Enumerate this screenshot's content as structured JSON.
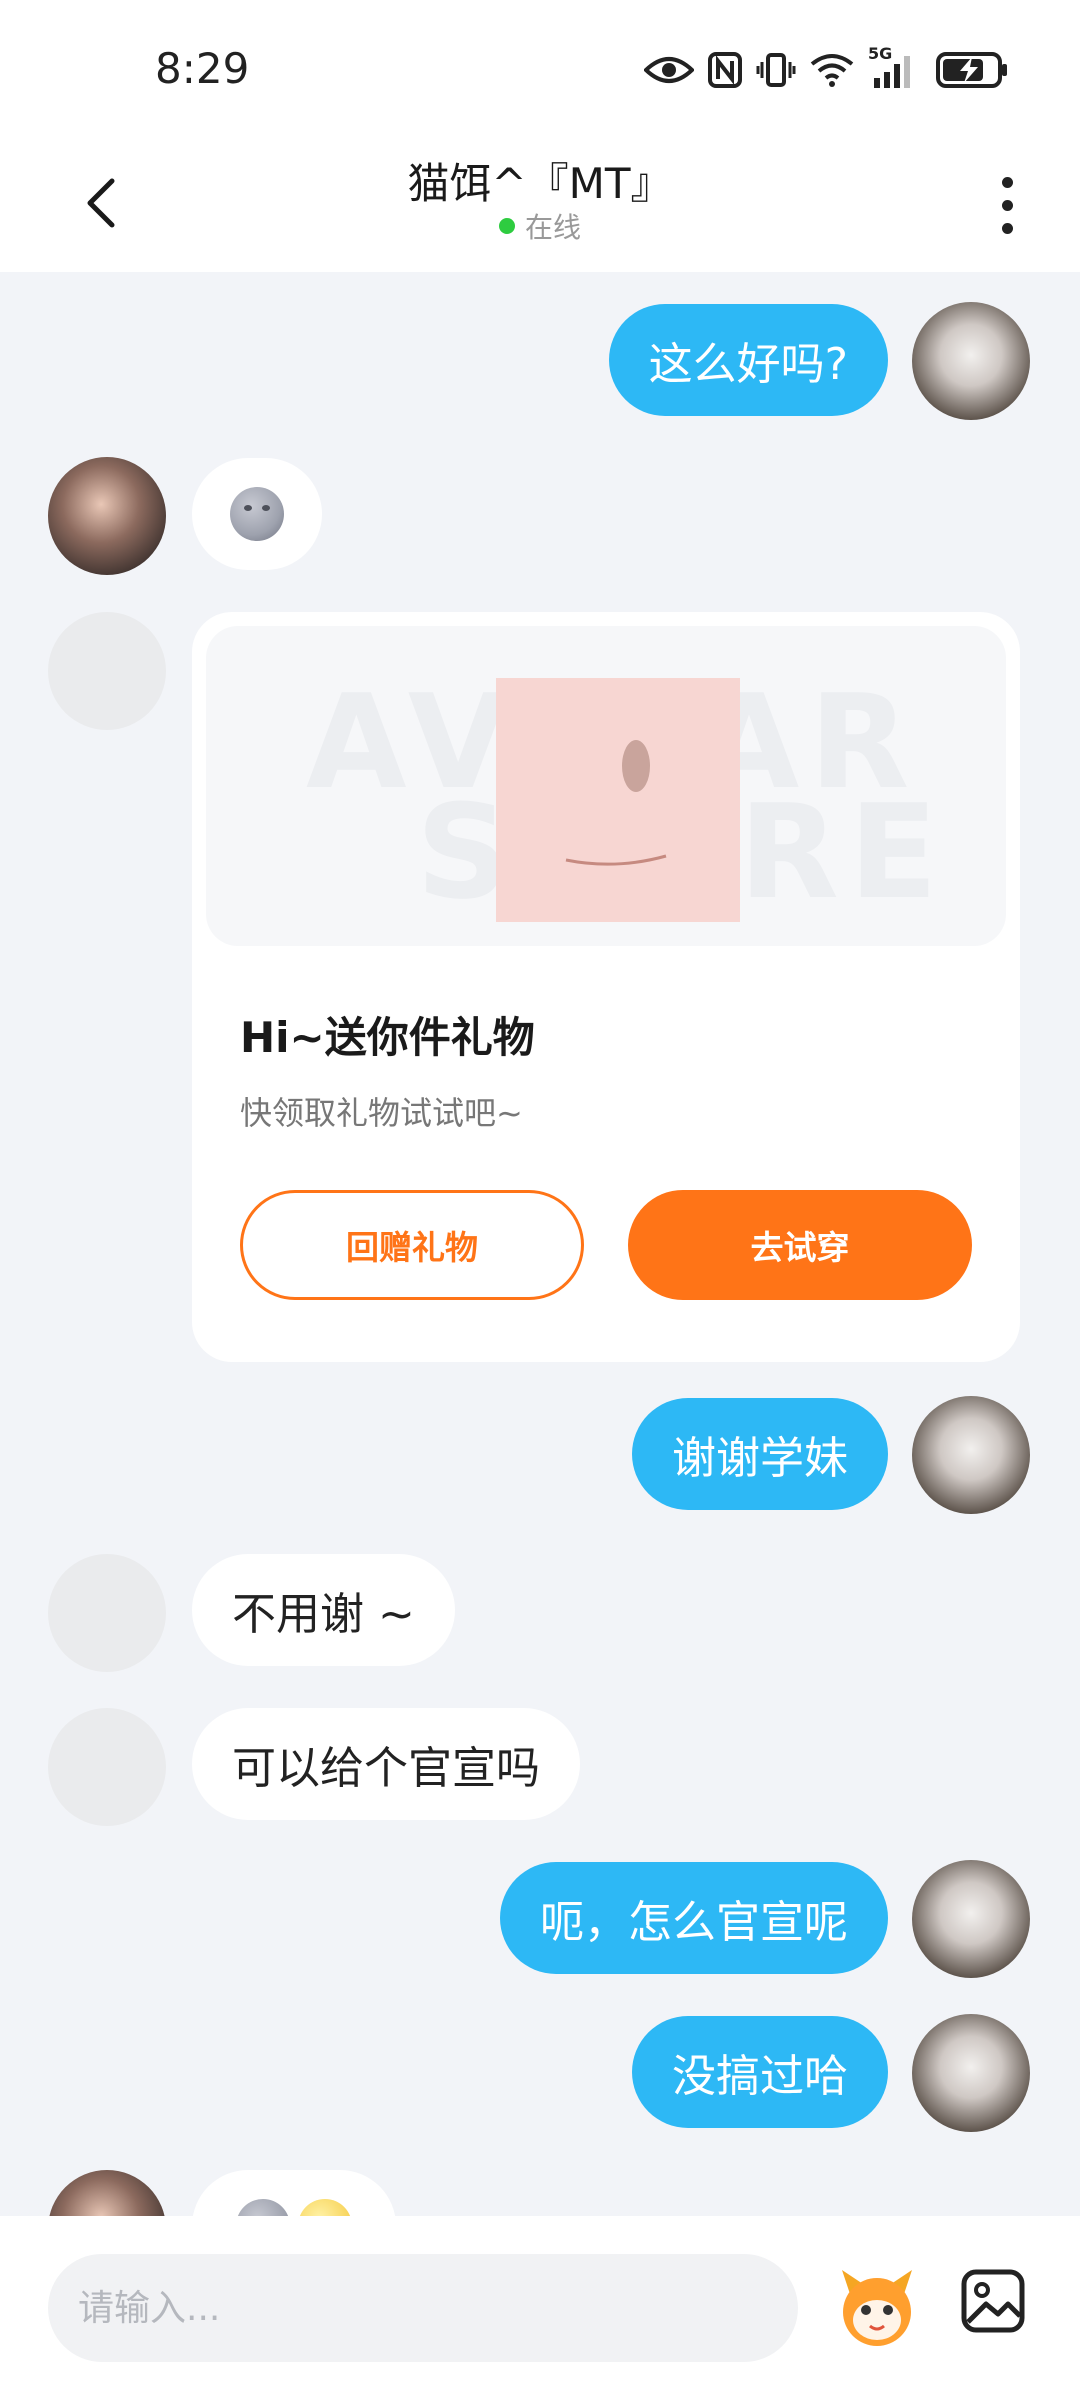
{
  "status_bar": {
    "time": "8:29",
    "network_label": "5G",
    "icons": [
      "eye-icon",
      "nfc-icon",
      "vibrate-icon",
      "wifi-icon",
      "signal-icon",
      "battery-charging-icon"
    ]
  },
  "header": {
    "title": "猫饵^『MT』",
    "status": "在线",
    "status_color": "#2ecc40"
  },
  "messages": [
    {
      "side": "me",
      "text": "这么好吗?"
    },
    {
      "side": "them",
      "emoji": "new-moon-face-emoji"
    },
    {
      "side": "them",
      "type": "gift_card"
    },
    {
      "side": "me",
      "text": "谢谢学妹"
    },
    {
      "side": "them",
      "text": "不用谢 ~"
    },
    {
      "side": "them",
      "text": "可以给个官宣吗"
    },
    {
      "side": "me",
      "text": "呃，怎么官宣呢"
    },
    {
      "side": "me",
      "text": "没搞过哈"
    },
    {
      "side": "them",
      "emoji": "moon-face-and-smiley-emoji"
    }
  ],
  "gift_card": {
    "watermark_line1": "AVATAR",
    "watermark_line2": "STORE",
    "title": "Hi~送你件礼物",
    "subtitle": "快领取礼物试试吧~",
    "return_gift_label": "回赠礼物",
    "try_on_label": "去试穿"
  },
  "input_bar": {
    "placeholder": "请输入..."
  },
  "colors": {
    "accent_blue": "#2db8f5",
    "accent_orange": "#ff7417",
    "background": "#f2f4f8"
  }
}
